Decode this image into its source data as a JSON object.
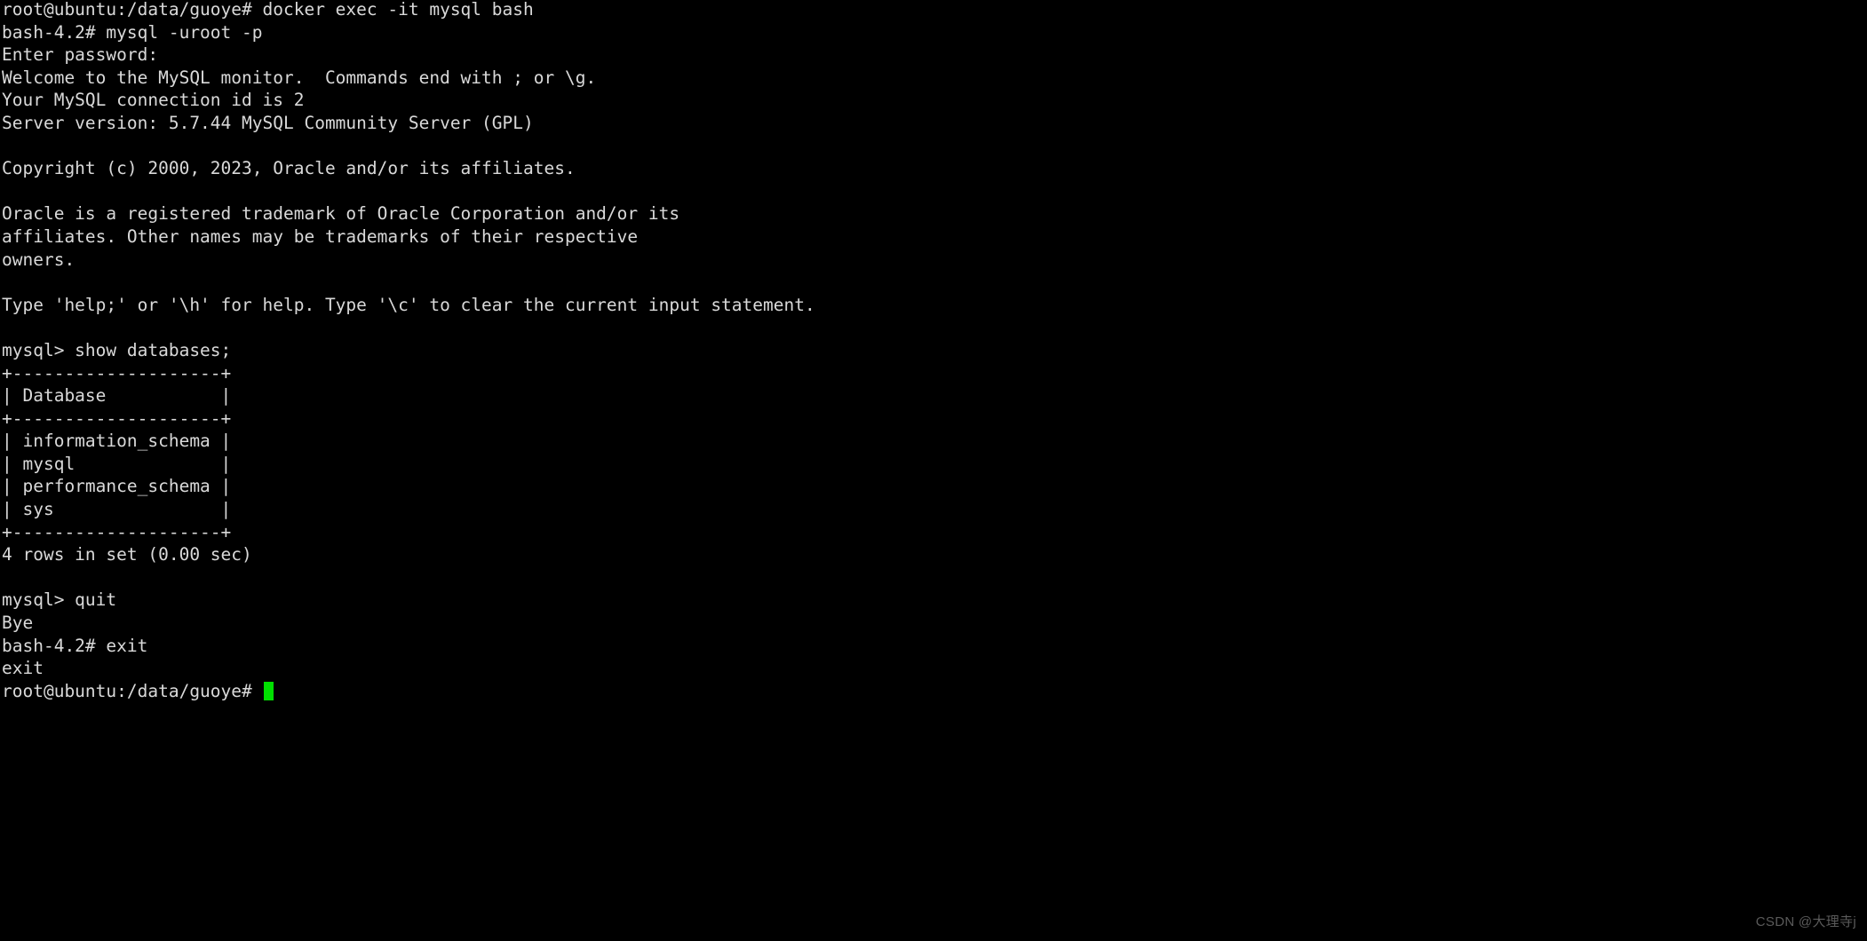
{
  "terminal": {
    "background_color": "#000000",
    "text_color": "#d9d9d9",
    "cursor_color": "#00e000",
    "lines": [
      "root@ubuntu:/data/guoye# docker exec -it mysql bash",
      "bash-4.2# mysql -uroot -p",
      "Enter password:",
      "Welcome to the MySQL monitor.  Commands end with ; or \\g.",
      "Your MySQL connection id is 2",
      "Server version: 5.7.44 MySQL Community Server (GPL)",
      "",
      "Copyright (c) 2000, 2023, Oracle and/or its affiliates.",
      "",
      "Oracle is a registered trademark of Oracle Corporation and/or its",
      "affiliates. Other names may be trademarks of their respective",
      "owners.",
      "",
      "Type 'help;' or '\\h' for help. Type '\\c' to clear the current input statement.",
      "",
      "mysql> show databases;",
      "+--------------------+",
      "| Database           |",
      "+--------------------+",
      "| information_schema |",
      "| mysql              |",
      "| performance_schema |",
      "| sys                |",
      "+--------------------+",
      "4 rows in set (0.00 sec)",
      "",
      "mysql> quit",
      "Bye",
      "bash-4.2# exit",
      "exit"
    ],
    "prompt_line": "root@ubuntu:/data/guoye# "
  },
  "session": {
    "host_prompt": "root@ubuntu:/data/guoye#",
    "container_prompt": "bash-4.2#",
    "mysql_prompt": "mysql>",
    "docker_command": "docker exec -it mysql bash",
    "mysql_command": "mysql -uroot -p",
    "password_prompt": "Enter password:",
    "server_version": "5.7.44 MySQL Community Server (GPL)",
    "connection_id": "2",
    "query": "show databases;",
    "row_count_message": "4 rows in set (0.00 sec)",
    "quit_command": "quit",
    "quit_response": "Bye",
    "exit_command": "exit",
    "databases": [
      "information_schema",
      "mysql",
      "performance_schema",
      "sys"
    ],
    "table_header": "Database"
  },
  "watermark": {
    "text": "CSDN @大理寺j"
  }
}
